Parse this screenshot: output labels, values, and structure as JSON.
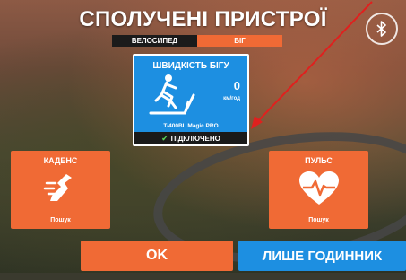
{
  "screen": {
    "title": "СПОЛУЧЕНІ ПРИСТРОЇ",
    "tabs": [
      {
        "label": "ВЕЛОСИПЕД",
        "active": false
      },
      {
        "label": "БІГ",
        "active": true
      }
    ]
  },
  "devices": {
    "speed": {
      "title": "ШВИДКІСТЬ БІГУ",
      "value": "0",
      "unit": "км/год",
      "device_name": "T-400BL Magic PRO",
      "status": "ПІДКЛЮЧЕНО"
    },
    "cadence": {
      "title": "КАДЕНС",
      "status": "Пошук"
    },
    "heart_rate": {
      "title": "ПУЛЬС",
      "status": "Пошук"
    }
  },
  "actions": {
    "ok_label": "OK",
    "watch_only_label": "ЛИШЕ ГОДИННИК"
  },
  "colors": {
    "accent_orange": "#f06a35",
    "accent_blue": "#1d8fe1",
    "connected_green": "#5ad35a",
    "annotation_red": "#e0201e"
  },
  "icons": [
    "bluetooth-icon",
    "runner-icon",
    "treadmill-icon",
    "check-icon",
    "shoe-icon",
    "heart-pulse-icon"
  ]
}
